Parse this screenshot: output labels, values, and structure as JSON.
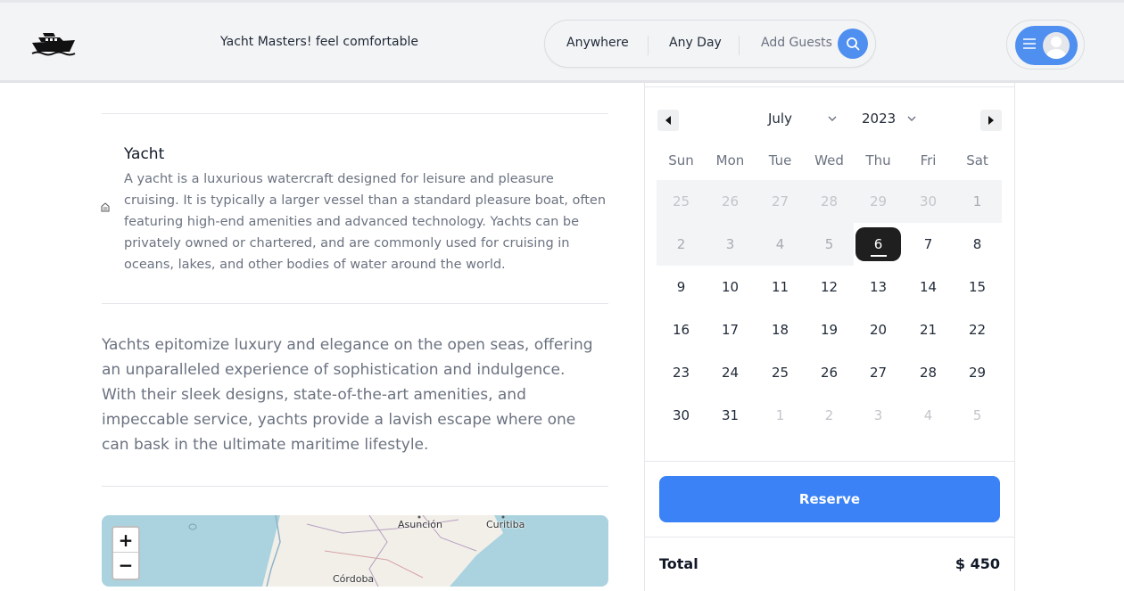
{
  "header": {
    "tagline": "Yacht Masters! feel comfortable",
    "search": {
      "where": "Anywhere",
      "when": "Any Day",
      "guests": "Add Guests"
    },
    "accent": "#4f8ff0"
  },
  "feature": {
    "title": "Yacht",
    "description": "A yacht is a luxurious watercraft designed for leisure and pleasure cruising. It is typically a larger vessel than a standard pleasure boat, often featuring high-end amenities and advanced technology. Yachts can be privately owned or chartered, and are commonly used for cruising in oceans, lakes, and other bodies of water around the world."
  },
  "about": "Yachts epitomize luxury and elegance on the open seas, offering an unparalleled experience of sophistication and indulgence. With their sleek designs, state-of-the-art amenities, and impeccable service, yachts provide a lavish escape where one can bask in the ultimate maritime lifestyle.",
  "map": {
    "zoom_in": "+",
    "zoom_out": "−",
    "labels": [
      "Asunción",
      "Curitiba",
      "Córdoba"
    ]
  },
  "calendar": {
    "month": "July",
    "year": "2023",
    "weekdays": [
      "Sun",
      "Mon",
      "Tue",
      "Wed",
      "Thu",
      "Fri",
      "Sat"
    ],
    "weeks": [
      [
        "25",
        "26",
        "27",
        "28",
        "29",
        "30",
        "1"
      ],
      [
        "2",
        "3",
        "4",
        "5",
        "6",
        "7",
        "8"
      ],
      [
        "9",
        "10",
        "11",
        "12",
        "13",
        "14",
        "15"
      ],
      [
        "16",
        "17",
        "18",
        "19",
        "20",
        "21",
        "22"
      ],
      [
        "23",
        "24",
        "25",
        "26",
        "27",
        "28",
        "29"
      ],
      [
        "30",
        "31",
        "1",
        "2",
        "3",
        "4",
        "5"
      ]
    ],
    "selected_day": "6",
    "selected_color": "#1f1f1f"
  },
  "booking": {
    "reserve_label": "Reserve",
    "reserve_color": "#3b82f6",
    "total_label": "Total",
    "total_value": "$ 450"
  }
}
